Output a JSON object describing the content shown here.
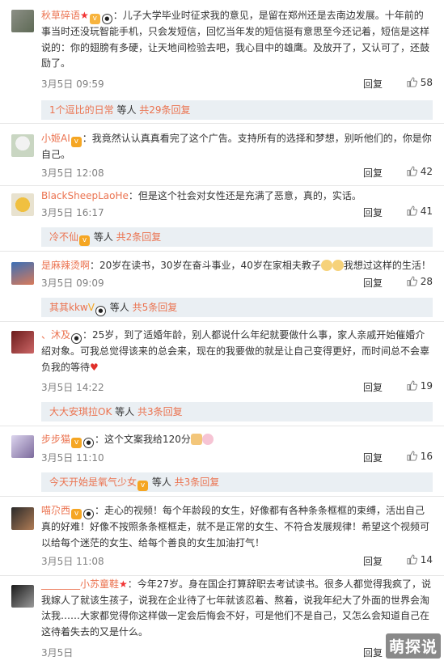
{
  "comments": [
    {
      "name": "秋草碎语",
      "text": "：儿子大学毕业时征求我的意见，是留在郑州还是去南边发展。十年前的事当时还没玩智能手机，只会发短信，回忆当年发的短信挺有意思至今还记着，短信是这样说的：你的翅膀有多硬，让天地间检验去吧，我心目中的雄鹰。及放开了，又认可了，还鼓励了。",
      "date": "3月5日 09:59",
      "reply": "回复",
      "likes": "58",
      "sub": {
        "name": "1个逗比的日常",
        "mid": " 等人 ",
        "count": "共29条回复"
      }
    },
    {
      "name": "小姬AI",
      "text": "：我竟然认认真真看完了这个广告。支持所有的选择和梦想，别听他们的，你是你自己。",
      "date": "3月5日 12:08",
      "reply": "回复",
      "likes": "42"
    },
    {
      "name": "BlackSheepLaoHe",
      "text": "：但是这个社会对女性还是充满了恶意，真的，实话。",
      "date": "3月5日 16:17",
      "reply": "回复",
      "likes": "41",
      "sub": {
        "name": "冷不仙",
        "mid": " 等人 ",
        "count": "共2条回复"
      }
    },
    {
      "name": "是麻辣烫啊",
      "text": "：20岁在读书，30岁在奋斗事业，40岁在家相夫教子",
      "text2": "我想过这样的生活！",
      "date": "3月5日 09:09",
      "reply": "回复",
      "likes": "28",
      "sub": {
        "name": "其其kkw",
        "mid": " 等人 ",
        "count": "共5条回复"
      }
    },
    {
      "name": "、沐及",
      "text": "：25岁，到了适婚年龄，别人都说什么年纪就要做什么事，家人亲戚开始催婚介绍对象。可我总觉得该来的总会来，现在的我要做的就是让自己变得更好，而时间总不会辜负我的等待",
      "date": "3月5日 14:22",
      "reply": "回复",
      "likes": "19",
      "sub": {
        "name": "大大安琪拉OK",
        "mid": " 等人 ",
        "count": "共3条回复"
      }
    },
    {
      "name": "步步猫",
      "text": "：这个文案我给120分",
      "date": "3月5日 11:10",
      "reply": "回复",
      "likes": "16",
      "sub": {
        "name": "今天开始是氧气少女",
        "mid": " 等人 ",
        "count": "共3条回复"
      }
    },
    {
      "name": "喵尕西",
      "text": "：走心的视频！每个年龄段的女生，好像都有各种条条框框的束缚，活出自己真的好难！好像不按照条条框框走，就不是正常的女生、不符合发展规律！希望这个视频可以给每个迷茫的女生、给每个善良的女生加油打气！",
      "date": "3月5日 11:08",
      "reply": "回复",
      "likes": "14"
    },
    {
      "name": "________小苏童鞋",
      "text": "：今年27岁。身在国企打算辞职去考试读书。很多人都觉得我疯了，说我嫁人了就该生孩子，说我在企业待了七年就该忍着、熬着，说我年纪大了外面的世界会淘汰我……大家都觉得你这样做一定会后悔会不好，可是他们不是自己，又怎么会知道自己在这待着失去的又是什么。",
      "date": "3月5日",
      "reply": "回复",
      "likes": ""
    }
  ],
  "watermark": "萌探说",
  "colors": {
    "name": "#eb7350",
    "text": "#333333",
    "meta": "#808080",
    "sub_bg": "#eaeff3"
  }
}
